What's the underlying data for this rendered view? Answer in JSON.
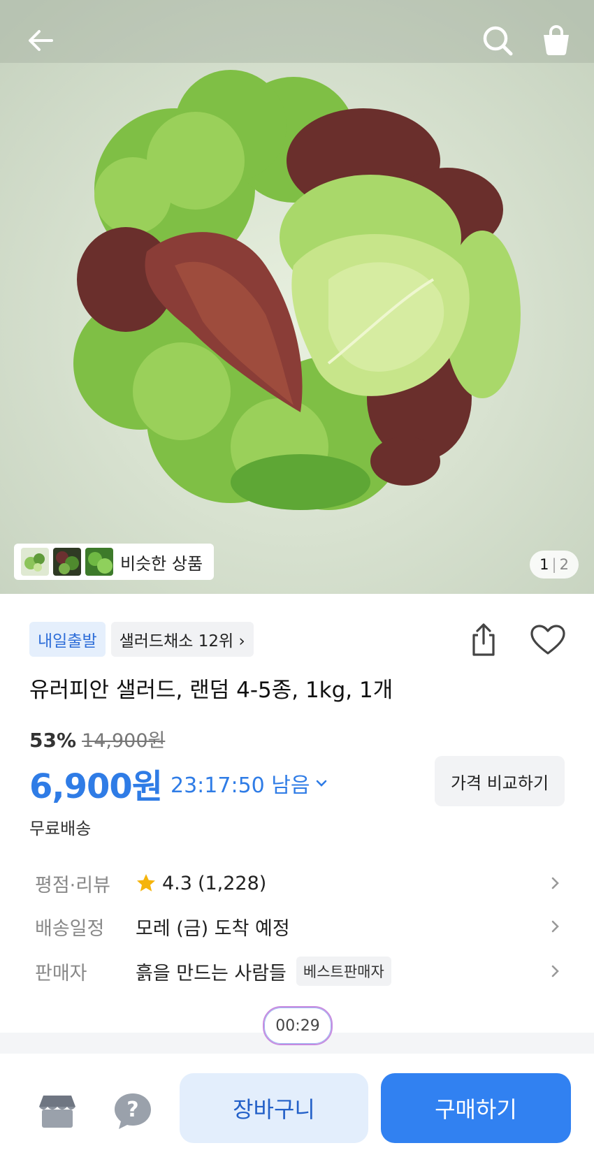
{
  "hero": {
    "similar_label": "비슷한 상품",
    "pager_current": "1",
    "pager_sep": "|",
    "pager_total": "2"
  },
  "product": {
    "tags": [
      "내일출발",
      "샐러드채소 12위 ›"
    ],
    "title": "유러피안 샐러드, 랜덤 4-5종, 1kg, 1개",
    "discount_pct": "53%",
    "original_price": "14,900원",
    "price": "6,900원",
    "timer": "23:17:50 남음",
    "compare_label": "가격 비교하기",
    "shipping": "무료배송"
  },
  "details": [
    {
      "key": "평점·리뷰",
      "rating": "4.3",
      "count": "(1,228)"
    },
    {
      "key": "배송일정",
      "value": "모레 (금) 도착 예정"
    },
    {
      "key": "판매자",
      "value": "흙을 만드는 사람들",
      "badge": "베스트판매자"
    }
  ],
  "recording_timer": "00:29",
  "bottom": {
    "cart_label": "장바구니",
    "buy_label": "구매하기"
  },
  "colors": {
    "accent": "#3181f1",
    "price_blue": "#2f7ce6",
    "star": "#f5b40b"
  },
  "icons": [
    "back-arrow-icon",
    "search-icon",
    "shopping-bag-icon",
    "share-icon",
    "heart-icon",
    "star-icon",
    "chevron-right-icon",
    "store-icon",
    "question-icon"
  ]
}
